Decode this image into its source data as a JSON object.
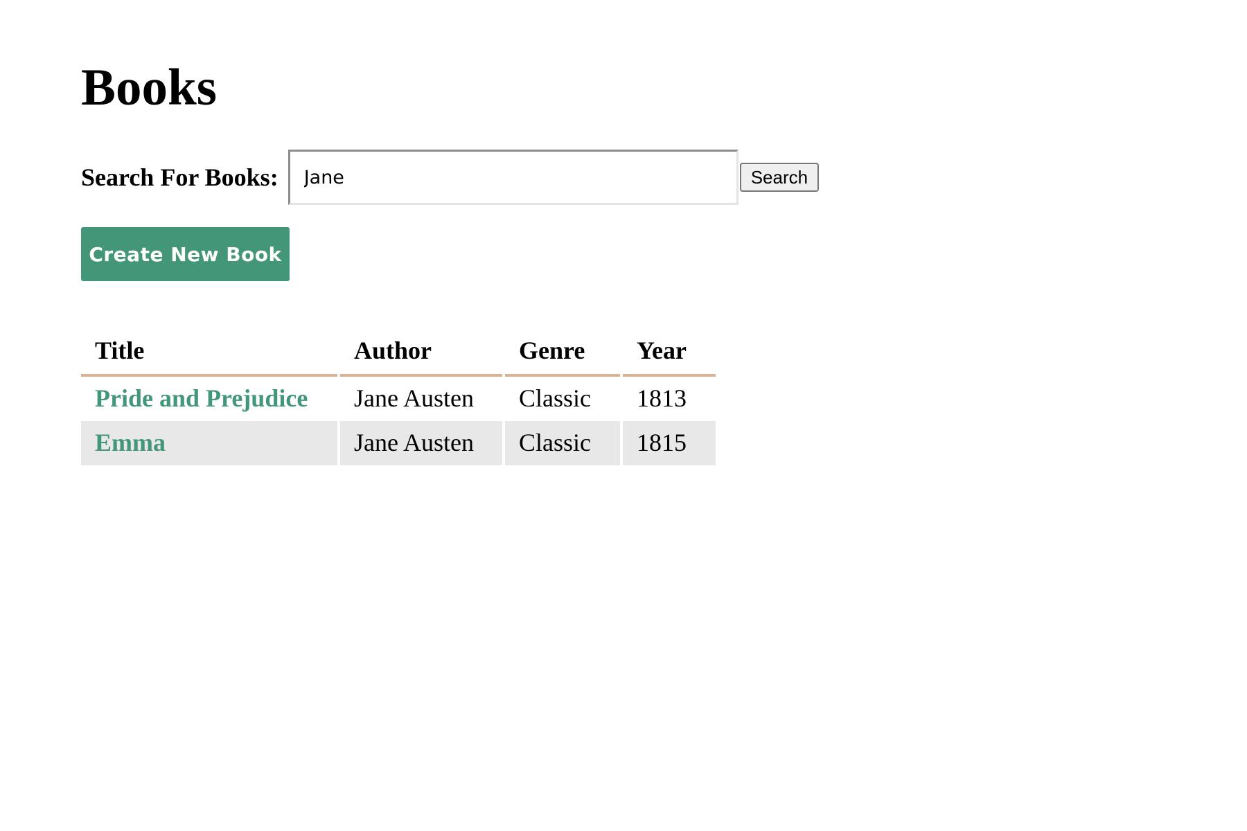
{
  "page": {
    "title": "Books"
  },
  "search": {
    "label": "Search For Books:",
    "value": "Jane",
    "placeholder": "",
    "button_label": "Search"
  },
  "actions": {
    "create_label": "Create New Book"
  },
  "table": {
    "headers": {
      "title": "Title",
      "author": "Author",
      "genre": "Genre",
      "year": "Year"
    },
    "rows": [
      {
        "title": "Pride and Prejudice",
        "author": "Jane Austen",
        "genre": "Classic",
        "year": "1813"
      },
      {
        "title": "Emma",
        "author": "Jane Austen",
        "genre": "Classic",
        "year": "1815"
      }
    ]
  },
  "colors": {
    "accent": "#439677",
    "header_rule": "#d5b394",
    "alt_row": "#e8e8e8"
  }
}
